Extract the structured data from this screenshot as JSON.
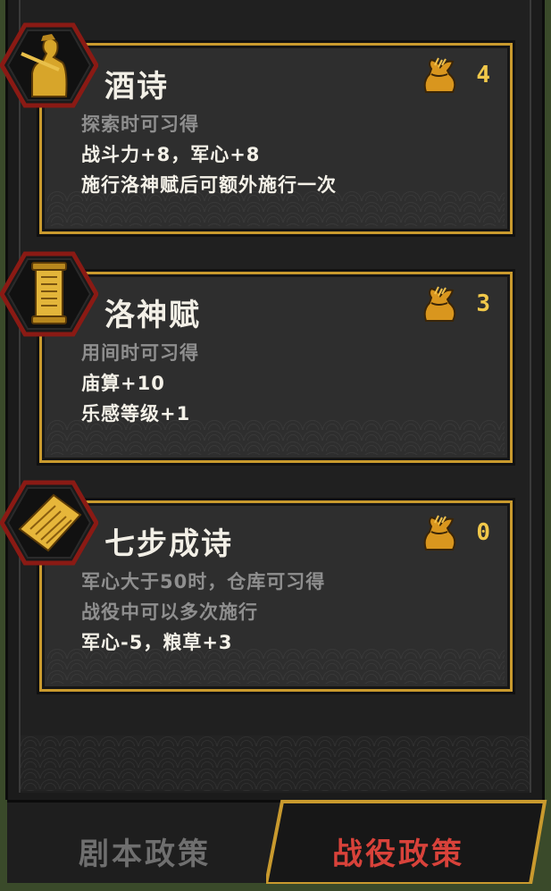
{
  "cards": [
    {
      "title": "酒诗",
      "cost": "4",
      "lines": [
        "探索时可习得",
        "战斗力+8，军心+8",
        "施行洛神赋后可额外施行一次"
      ]
    },
    {
      "title": "洛神赋",
      "cost": "3",
      "lines": [
        "用间时可习得",
        "庙算+10",
        "乐感等级+1"
      ]
    },
    {
      "title": "七步成诗",
      "cost": "0",
      "lines": [
        "军心大于50时，仓库可习得",
        "战役中可以多次施行",
        "军心-5，粮草+3"
      ]
    }
  ],
  "tabs": {
    "script_policy": "剧本政策",
    "campaign_policy": "战役政策"
  },
  "colors": {
    "card_border": "#c99a2e",
    "hex_border": "#8a1a14",
    "active_tab_text": "#d8423a",
    "cost_text": "#f1c84a"
  },
  "icons": [
    "warrior-portrait-icon",
    "scroll-icon",
    "paper-sheet-icon",
    "grain-sack-icon"
  ]
}
